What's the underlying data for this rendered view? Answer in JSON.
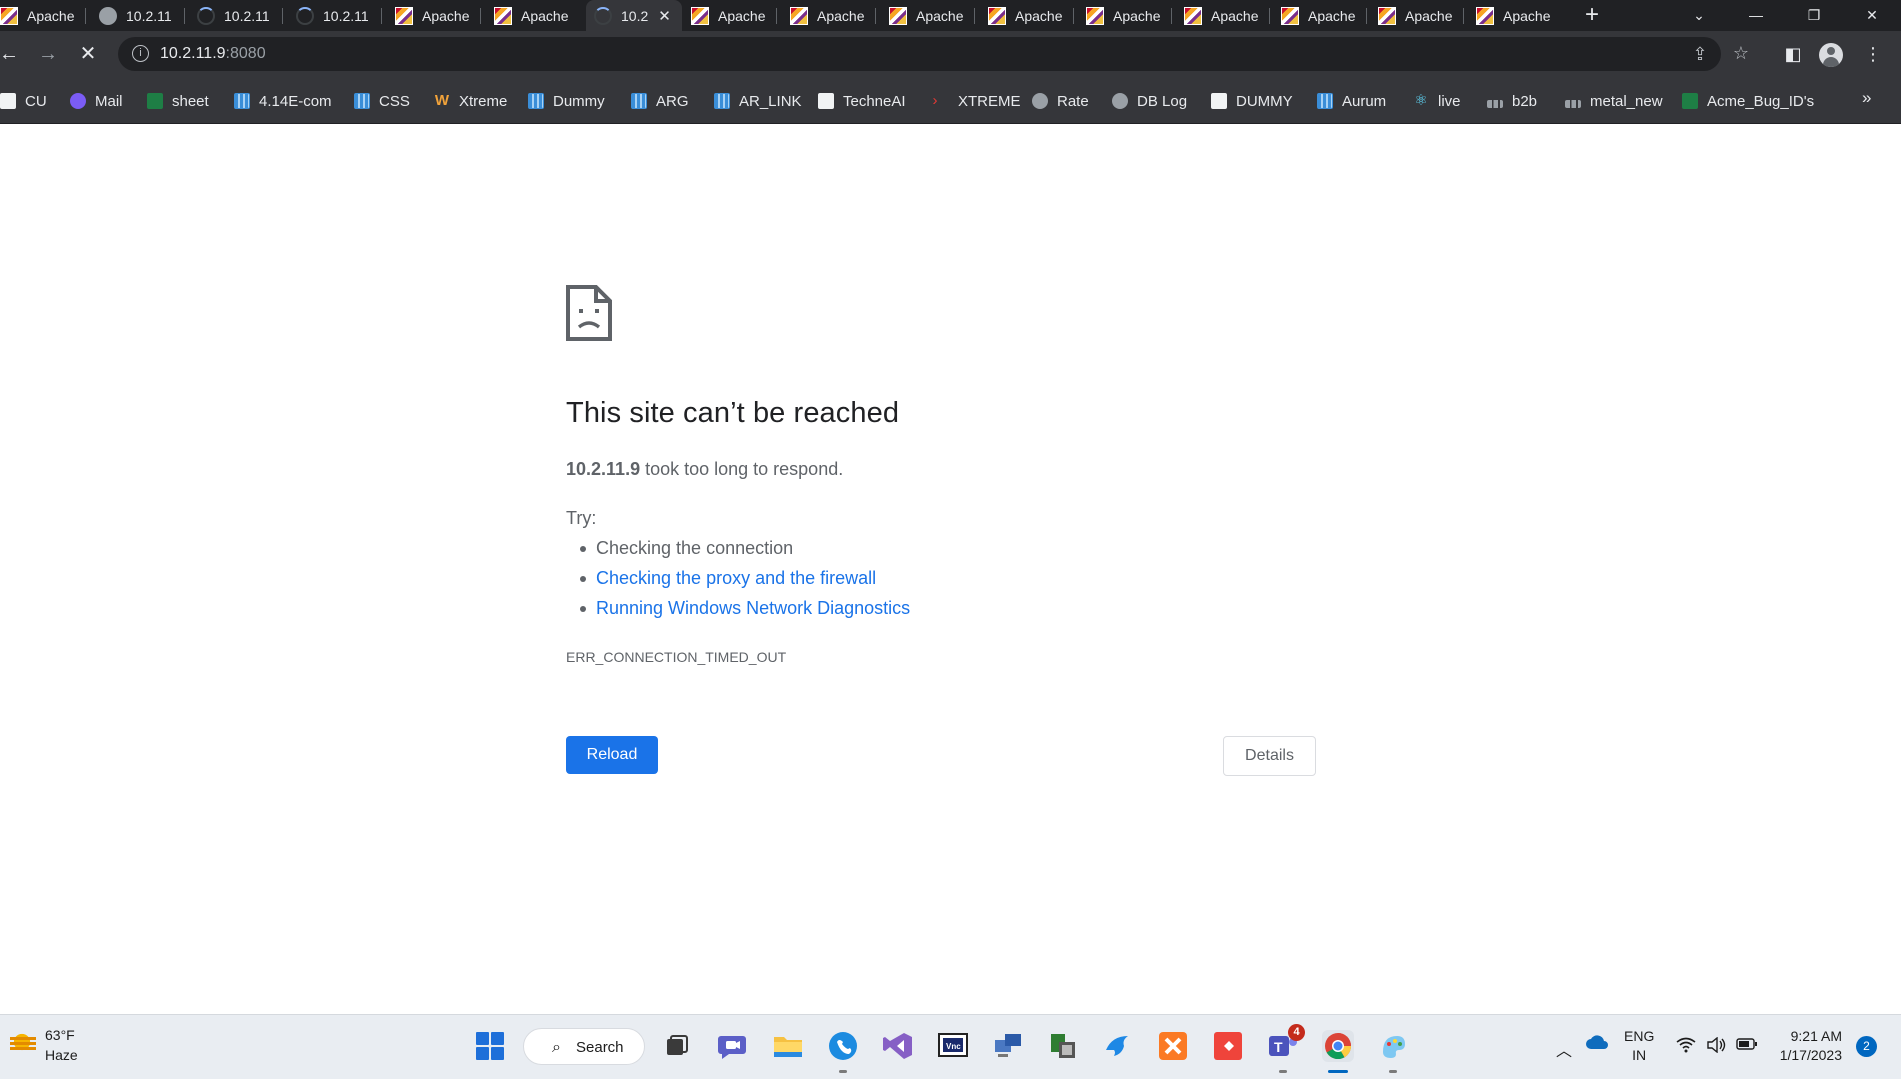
{
  "tabs": [
    {
      "title": "Apache",
      "icon": "apache-icon"
    },
    {
      "title": "10.2.11",
      "icon": "globe-icon"
    },
    {
      "title": "10.2.11",
      "icon": "loading-spinner-icon"
    },
    {
      "title": "10.2.11",
      "icon": "loading-spinner-icon"
    },
    {
      "title": "Apache",
      "icon": "apache-icon"
    },
    {
      "title": "Apache",
      "icon": "apache-icon"
    },
    {
      "title": "10.2",
      "icon": "loading-spinner-icon",
      "active": true
    },
    {
      "title": "Apache",
      "icon": "apache-icon"
    },
    {
      "title": "Apache",
      "icon": "apache-icon"
    },
    {
      "title": "Apache",
      "icon": "apache-icon"
    },
    {
      "title": "Apache",
      "icon": "apache-icon"
    },
    {
      "title": "Apache",
      "icon": "apache-icon"
    },
    {
      "title": "Apache",
      "icon": "apache-icon"
    },
    {
      "title": "Apache",
      "icon": "apache-icon"
    },
    {
      "title": "Apache",
      "icon": "apache-icon"
    },
    {
      "title": "Apache",
      "icon": "apache-icon"
    }
  ],
  "omnibox": {
    "host": "10.2.11.9",
    "port": ":8080"
  },
  "bookmarks": [
    {
      "label": "CU",
      "icon": "page-icon"
    },
    {
      "label": "Mail",
      "icon": "mail-icon"
    },
    {
      "label": "sheet",
      "icon": "excel-icon"
    },
    {
      "label": "4.14E-com",
      "icon": "grid-icon"
    },
    {
      "label": "CSS",
      "icon": "grid-icon"
    },
    {
      "label": "Xtreme",
      "icon": "w-icon"
    },
    {
      "label": "Dummy",
      "icon": "grid-icon"
    },
    {
      "label": "ARG",
      "icon": "grid-icon"
    },
    {
      "label": "AR_LINK",
      "icon": "grid-icon"
    },
    {
      "label": "TechneAI",
      "icon": "page-icon"
    },
    {
      "label": "XTREME",
      "icon": "chevron-icon"
    },
    {
      "label": "Rate",
      "icon": "globe-icon"
    },
    {
      "label": "DB Log",
      "icon": "globe-icon"
    },
    {
      "label": "DUMMY",
      "icon": "page-icon"
    },
    {
      "label": "Aurum",
      "icon": "grid-icon"
    },
    {
      "label": "live",
      "icon": "react-icon"
    },
    {
      "label": "b2b",
      "icon": "bar-icon"
    },
    {
      "label": "metal_new",
      "icon": "bar-icon"
    },
    {
      "label": "Acme_Bug_ID's",
      "icon": "excel-icon"
    }
  ],
  "error": {
    "title": "This site can’t be reached",
    "host": "10.2.11.9",
    "desc_suffix": " took too long to respond.",
    "try_label": "Try:",
    "suggestions": [
      {
        "text": "Checking the connection",
        "link": false
      },
      {
        "text": "Checking the proxy and the firewall",
        "link": true
      },
      {
        "text": "Running Windows Network Diagnostics",
        "link": true
      }
    ],
    "code": "ERR_CONNECTION_TIMED_OUT",
    "reload_label": "Reload",
    "details_label": "Details"
  },
  "taskbar": {
    "weather_temp": "63°F",
    "weather_desc": "Haze",
    "search_label": "Search",
    "teams_badge": "4",
    "lang_line1": "ENG",
    "lang_line2": "IN",
    "time": "9:21 AM",
    "date": "1/17/2023",
    "notifications": "2"
  },
  "colors": {
    "link": "#1a73e8",
    "reload_button": "#1a73e8",
    "tabstrip": "#202124",
    "toolbar": "#35363a"
  }
}
